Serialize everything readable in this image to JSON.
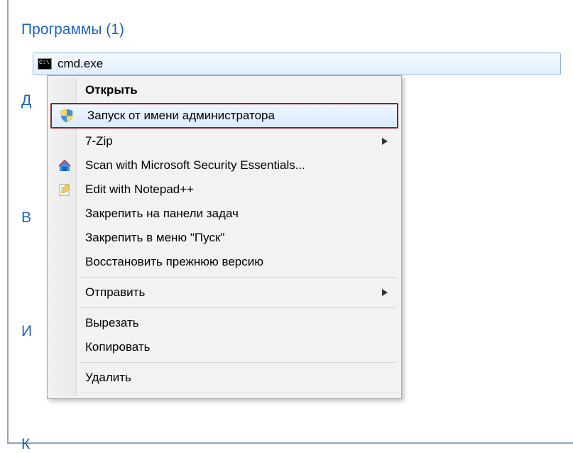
{
  "sections": {
    "programs_header": "Программы (1)",
    "d": "Д",
    "v": "В",
    "i": "И",
    "k": "К"
  },
  "search_result": {
    "filename": "cmd.exe"
  },
  "context_menu": {
    "open": "Открыть",
    "run_as_admin": "Запуск от имени администратора",
    "sevenzip": "7-Zip",
    "mse": "Scan with Microsoft Security Essentials...",
    "npp": "Edit with Notepad++",
    "pin_taskbar": "Закрепить на панели задач",
    "pin_start": "Закрепить в меню \"Пуск\"",
    "restore_prev": "Восстановить прежнюю версию",
    "send_to": "Отправить",
    "cut": "Вырезать",
    "copy": "Копировать",
    "delete": "Удалить"
  }
}
